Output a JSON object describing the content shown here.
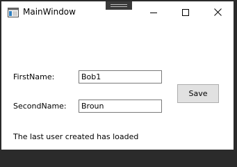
{
  "window": {
    "title": "MainWindow",
    "icon": "window-app-icon",
    "controls": [
      "minimize-icon",
      "maximize-icon",
      "close-icon"
    ]
  },
  "form": {
    "first_name_label": "FirstName:",
    "first_name_value": "Bob1",
    "second_name_label": "SecondName:",
    "second_name_value": "Broun",
    "save_label": "Save"
  },
  "status": {
    "message": "The last user created has loaded"
  }
}
